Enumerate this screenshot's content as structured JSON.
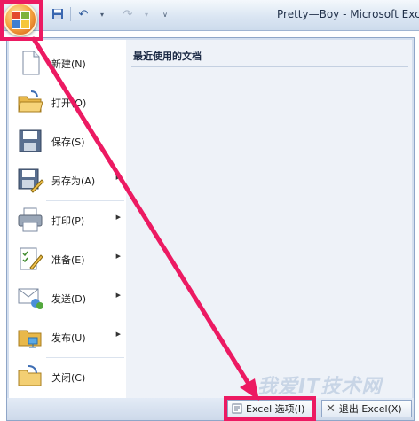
{
  "window": {
    "title": "Pretty—Boy - Microsoft Excel"
  },
  "quick_access": {
    "save_icon": "save-icon",
    "undo_icon": "undo-icon",
    "redo_icon": "redo-icon",
    "customize_icon": "customize-qat-icon"
  },
  "office_menu": {
    "items": [
      {
        "label": "新建(N)",
        "icon": "new-document-icon",
        "submenu": false
      },
      {
        "label": "打开(O)",
        "icon": "open-folder-icon",
        "submenu": false
      },
      {
        "label": "保存(S)",
        "icon": "save-disk-icon",
        "submenu": false
      },
      {
        "label": "另存为(A)",
        "icon": "save-as-icon",
        "submenu": true
      },
      {
        "label": "打印(P)",
        "icon": "printer-icon",
        "submenu": true
      },
      {
        "label": "准备(E)",
        "icon": "prepare-icon",
        "submenu": true
      },
      {
        "label": "发送(D)",
        "icon": "send-icon",
        "submenu": true
      },
      {
        "label": "发布(U)",
        "icon": "publish-icon",
        "submenu": true
      },
      {
        "label": "关闭(C)",
        "icon": "close-folder-icon",
        "submenu": false
      }
    ],
    "recent_title": "最近使用的文档",
    "options_button": "Excel 选项(I)",
    "exit_button": "退出 Excel(X)"
  },
  "watermark": "我爱IT技术网",
  "colors": {
    "highlight": "#ec1a62",
    "menu_bg": "#d4dfef"
  }
}
